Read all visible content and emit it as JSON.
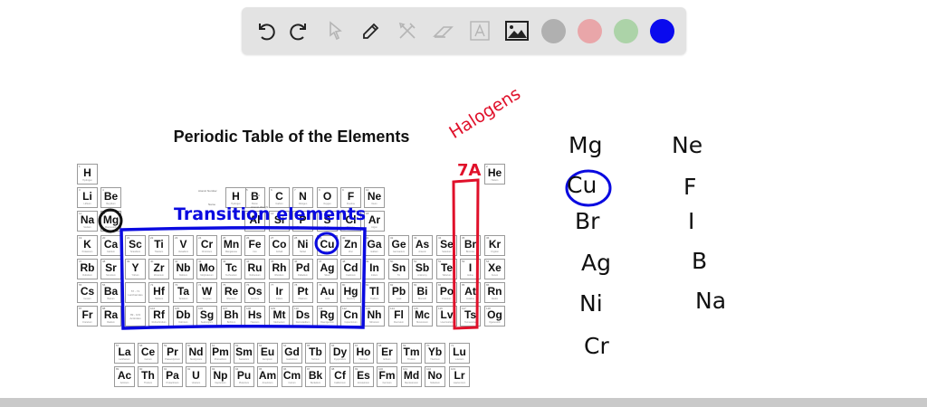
{
  "toolbar": {
    "tools": [
      "undo",
      "redo",
      "select",
      "pen",
      "tools",
      "eraser",
      "text",
      "image"
    ],
    "colors": [
      "#b0b0b0",
      "#e9a6a9",
      "#acd3a8",
      "#0a0aee"
    ],
    "selected_color": "#0a0aee"
  },
  "title": "Periodic Table of the Elements",
  "legend": {
    "atomic_number": "Atomic Number",
    "name": "Name",
    "symbol": "Symbol",
    "atomic_weight": "Atomic Weight",
    "sample_symbol": "H",
    "sample_name": "Hydrogen"
  },
  "placeholders": {
    "lanthanides": "57 - 71 Lanthanides",
    "actinides": "89 - 103 Actinides"
  },
  "elements": [
    "H|Hydrogen",
    "He|Helium",
    "Li|Lithium",
    "Be|Beryllium",
    "B|Boron",
    "C|Carbon",
    "N|Nitrogen",
    "O|Oxygen",
    "F|Fluorine",
    "Ne|Neon",
    "Na|Sodium",
    "Mg|Magnesium",
    "Al|Aluminum",
    "Si|Silicon",
    "P|Phosphorus",
    "S|Sulfur",
    "Cl|Chlorine",
    "Ar|Argon",
    "K|Potassium",
    "Ca|Calcium",
    "Sc|Scandium",
    "Ti|Titanium",
    "V|Vanadium",
    "Cr|Chromium",
    "Mn|Manganese",
    "Fe|Iron",
    "Co|Cobalt",
    "Ni|Nickel",
    "Cu|Copper",
    "Zn|Zinc",
    "Ga|Gallium",
    "Ge|Germanium",
    "As|Arsenic",
    "Se|Selenium",
    "Br|Bromine",
    "Kr|Krypton",
    "Rb|Rubidium",
    "Sr|Strontium",
    "Y|Yttrium",
    "Zr|Zirconium",
    "Nb|Niobium",
    "Mo|Molybdenum",
    "Tc|Technetium",
    "Ru|Ruthenium",
    "Rh|Rhodium",
    "Pd|Palladium",
    "Ag|Silver",
    "Cd|Cadmium",
    "In|Indium",
    "Sn|Tin",
    "Sb|Antimony",
    "Te|Tellurium",
    "I|Iodine",
    "Xe|Xenon",
    "Cs|Cesium",
    "Ba|Barium",
    "La|Lanthanum",
    "Ce|Cerium",
    "Pr|Praseodymium",
    "Nd|Neodymium",
    "Pm|Promethium",
    "Sm|Samarium",
    "Eu|Europium",
    "Gd|Gadolinium",
    "Tb|Terbium",
    "Dy|Dysprosium",
    "Ho|Holmium",
    "Er|Erbium",
    "Tm|Thulium",
    "Yb|Ytterbium",
    "Lu|Lutetium",
    "Hf|Hafnium",
    "Ta|Tantalum",
    "W|Tungsten",
    "Re|Rhenium",
    "Os|Osmium",
    "Ir|Iridium",
    "Pt|Platinum",
    "Au|Gold",
    "Hg|Mercury",
    "Tl|Thallium",
    "Pb|Lead",
    "Bi|Bismuth",
    "Po|Polonium",
    "At|Astatine",
    "Rn|Radon",
    "Fr|Francium",
    "Ra|Radium",
    "Ac|Actinium",
    "Th|Thorium",
    "Pa|Protactinium",
    "U|Uranium",
    "Np|Neptunium",
    "Pu|Plutonium",
    "Am|Americium",
    "Cm|Curium",
    "Bk|Berkelium",
    "Cf|Californium",
    "Es|Einsteinium",
    "Fm|Fermium",
    "Md|Mendelevium",
    "No|Nobelium",
    "Lr|Lawrencium",
    "Rf|Rutherfordium",
    "Db|Dubnium",
    "Sg|Seaborgium",
    "Bh|Bohrium",
    "Hs|Hassium",
    "Mt|Meitnerium",
    "Ds|Darmstadtium",
    "Rg|Roentgenium",
    "Cn|Copernicium",
    "Nh|Nihonium",
    "Fl|Flerovium",
    "Mc|Moscovium",
    "Lv|Livermorium",
    "Ts|Tennessine",
    "Og|Oganesson"
  ],
  "annotations": {
    "halogens": "Halogens",
    "group_label": "7A",
    "transition": "Transition elements",
    "list_left": [
      "Mg",
      "Cu",
      "Br",
      "Ag",
      "Ni",
      "Cr"
    ],
    "list_right": [
      "Ne",
      "F",
      "I",
      "B",
      "Na"
    ],
    "colors": {
      "blue": "#0a0ae0",
      "red": "#e0102a",
      "black": "#111111"
    }
  }
}
